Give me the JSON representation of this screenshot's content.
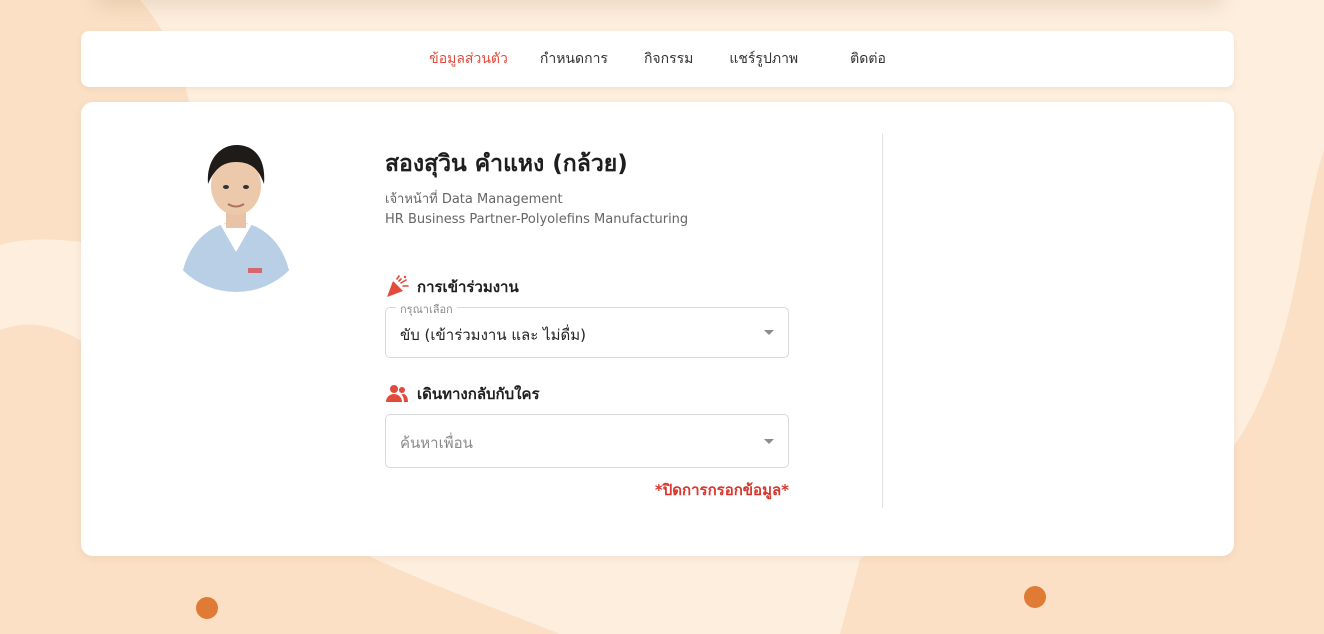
{
  "colors": {
    "background": "#fdeede",
    "accent": "#e24b3b",
    "closed_note": "#d8362e",
    "dot": "#e07b35"
  },
  "nav": {
    "items": [
      {
        "label": "ข้อมูลส่วนตัว",
        "active": true
      },
      {
        "label": "กำหนดการ",
        "active": false
      },
      {
        "label": "กิจกรรม",
        "active": false
      },
      {
        "label": "แชร์รูปภาพ",
        "active": false
      },
      {
        "label": "ติดต่อ",
        "active": false
      }
    ]
  },
  "profile": {
    "name": "สองสุวิน คำแหง (กล้วย)",
    "position": "เจ้าหน้าที่ Data Management",
    "department": "HR Business Partner-Polyolefins Manufacturing"
  },
  "attendance": {
    "icon": "party-popper-icon",
    "title": "การเข้าร่วมงาน",
    "legend": "กรุณาเลือก",
    "selected": "ขับ (เข้าร่วมงาน และ ไม่ดื่ม)"
  },
  "travel": {
    "icon": "people-icon",
    "title": "เดินทางกลับกับใคร",
    "placeholder": "ค้นหาเพื่อน"
  },
  "closed_note": "*ปิดการกรอกข้อมูล*"
}
